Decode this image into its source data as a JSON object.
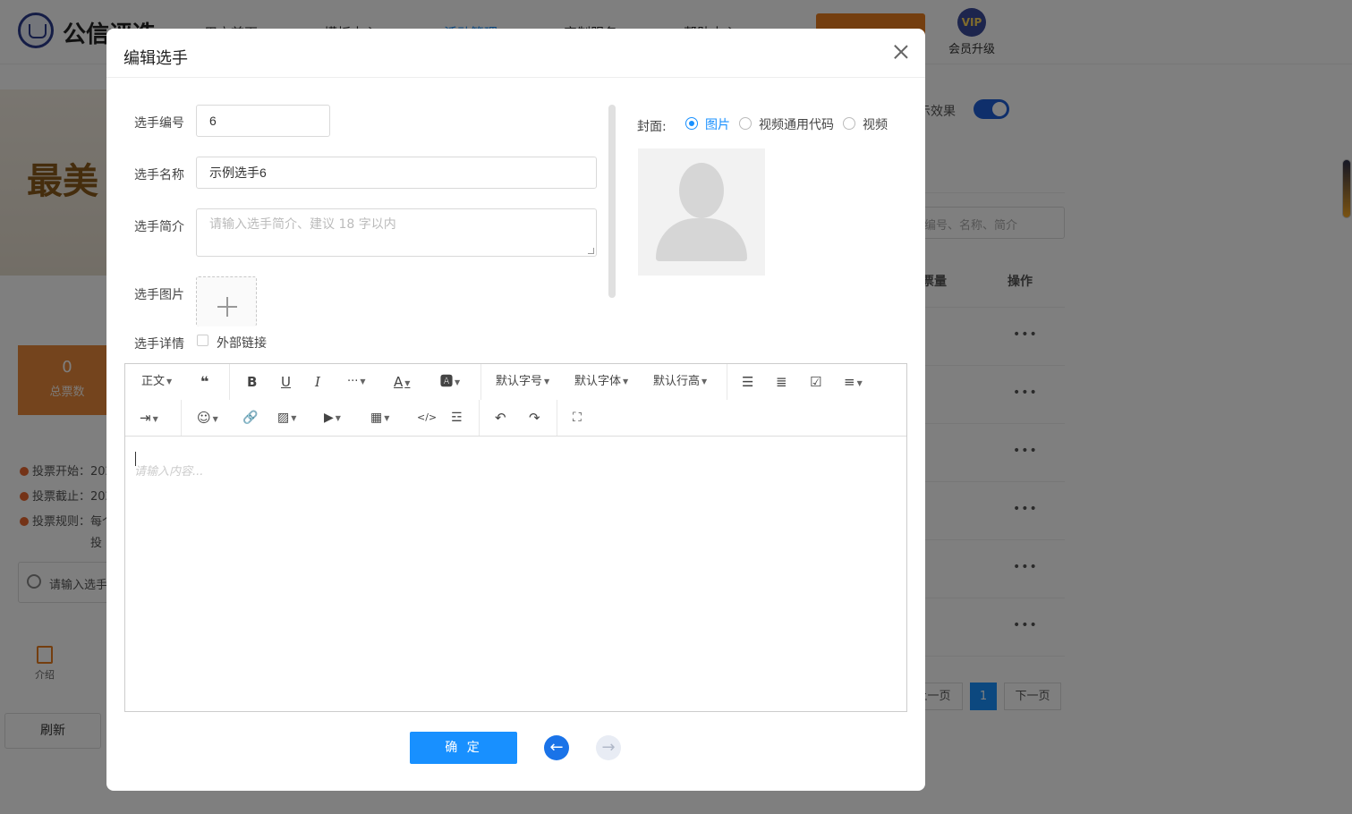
{
  "background": {
    "brand": "公信评选",
    "nav": [
      "用户首页",
      "模板中心",
      "活动管理",
      "定制服务",
      "帮助中心"
    ],
    "vip_badge": "VIP",
    "vip_label": "会员升级",
    "banner_text": "最美",
    "stat_value": "0",
    "stat_label": "总票数",
    "rules": [
      "投票开始：202",
      "投票截止：202",
      "投票规则：每个"
    ],
    "rule_cont": "投",
    "left_search_placeholder": "请输入选手",
    "intro_label": "介绍",
    "refresh_label": "刷新",
    "toggle_label": "显示效果",
    "right_search_placeholder": "编号、名称、简介",
    "col_votes": "票量",
    "col_action": "操作",
    "row_action": "•••",
    "pager": {
      "prev": "上一页",
      "current": "1",
      "next": "下一页"
    }
  },
  "modal": {
    "title": "编辑选手",
    "fields": {
      "number_label": "选手编号",
      "number_value": "6",
      "name_label": "选手名称",
      "name_value": "示例选手6",
      "intro_label": "选手简介",
      "intro_placeholder": "请输入选手简介、建议 18 字以内",
      "image_label": "选手图片",
      "detail_label": "选手详情",
      "external_link_label": "外部链接"
    },
    "cover": {
      "label": "封面:",
      "options": [
        "图片",
        "视频通用代码",
        "视频"
      ],
      "selected": "图片"
    },
    "toolbar": {
      "paragraph": "正文",
      "font_size": "默认字号",
      "font_family": "默认字体",
      "line_height": "默认行高"
    },
    "editor_placeholder": "请输入内容...",
    "confirm_label": "确 定",
    "prev_arrow": "←",
    "next_arrow": "→"
  },
  "colors": {
    "primary": "#1890ff",
    "accent_orange": "#e8893a",
    "toggle": "#1f5fd6",
    "prev_arrow": "#1a73e8"
  }
}
